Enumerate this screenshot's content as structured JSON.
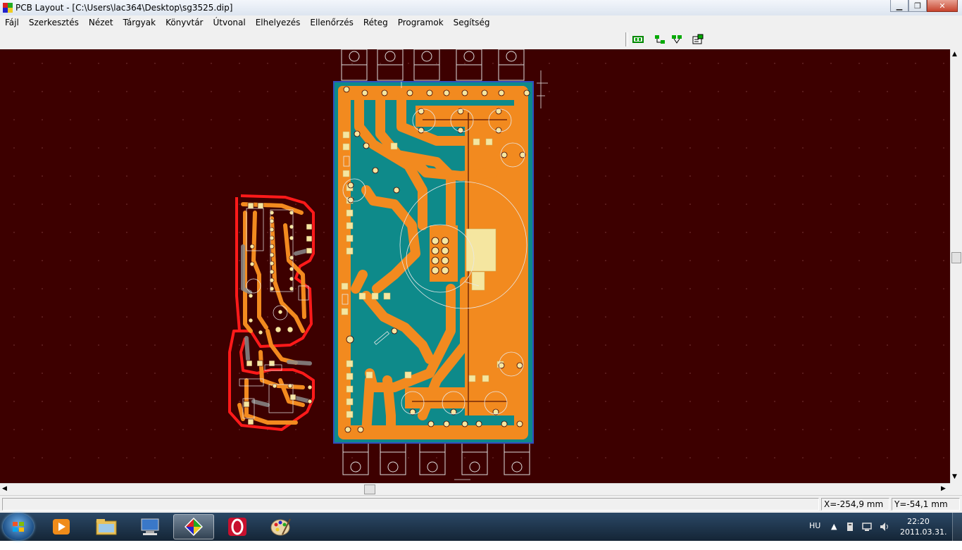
{
  "window": {
    "title": "PCB Layout - [C:\\Users\\lac364\\Desktop\\sg3525.dip]"
  },
  "menu": [
    "Fájl",
    "Szerkesztés",
    "Nézet",
    "Tárgyak",
    "Könyvtár",
    "Útvonal",
    "Elhelyezés",
    "Ellenőrzés",
    "Réteg",
    "Programok",
    "Segítség"
  ],
  "toolbar_icons": [
    "component-icon",
    "route-icon",
    "autoroute-icon",
    "properties-icon"
  ],
  "status": {
    "x_coord": "X=-254,9 mm",
    "y_coord": "Y=-54,1 mm"
  },
  "taskbar": {
    "apps": [
      "media-player-icon",
      "explorer-icon",
      "remote-desktop-icon",
      "pcb-layout-icon",
      "opera-icon",
      "paint-icon"
    ],
    "lang": "HU",
    "time": "22:20",
    "date": "2011.03.31."
  },
  "colors": {
    "canvas": "#3d0000",
    "board_copper": "#f28a1f",
    "board_substrate": "#0e8a8a",
    "outline": "#ff1a1a",
    "pad": "#f5e6a0"
  }
}
